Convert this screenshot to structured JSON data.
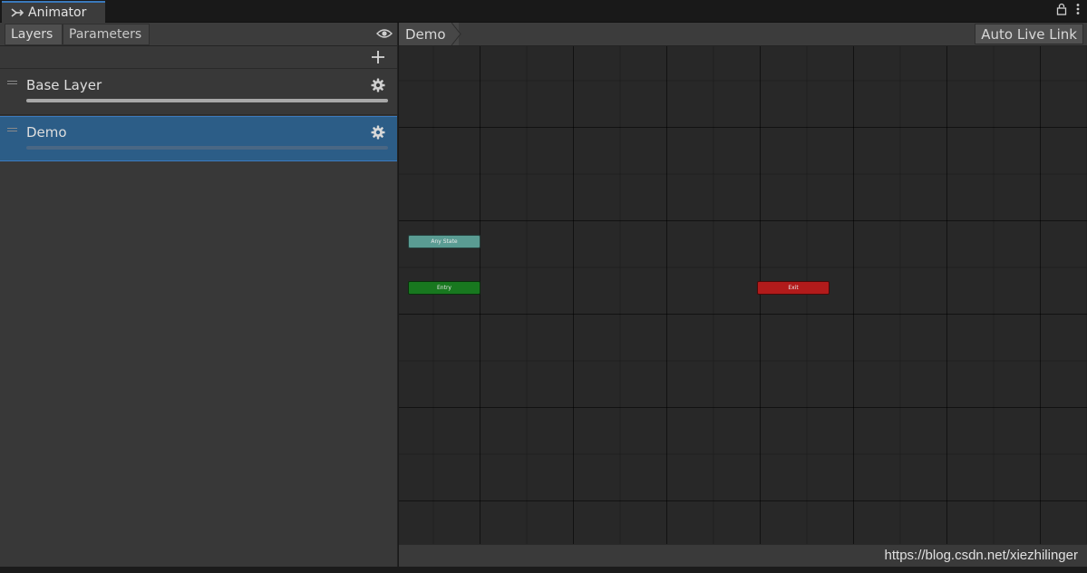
{
  "window": {
    "tab_label": "Animator"
  },
  "left_panel": {
    "tabs": [
      {
        "label": "Layers",
        "active": true
      },
      {
        "label": "Parameters",
        "active": false
      }
    ],
    "layers": [
      {
        "name": "Base Layer",
        "selected": false
      },
      {
        "name": "Demo",
        "selected": true
      }
    ]
  },
  "graph": {
    "breadcrumb": "Demo",
    "auto_live_link_label": "Auto Live Link",
    "nodes": {
      "any_state": "Any State",
      "entry": "Entry",
      "exit": "Exit"
    },
    "status_text": "https://blog.csdn.net/xiezhilinger"
  },
  "colors": {
    "accent": "#3a79bb",
    "selected_layer": "#2c5d87",
    "any_state": "#5a9c93",
    "entry": "#18781f",
    "exit": "#b21b1b"
  }
}
